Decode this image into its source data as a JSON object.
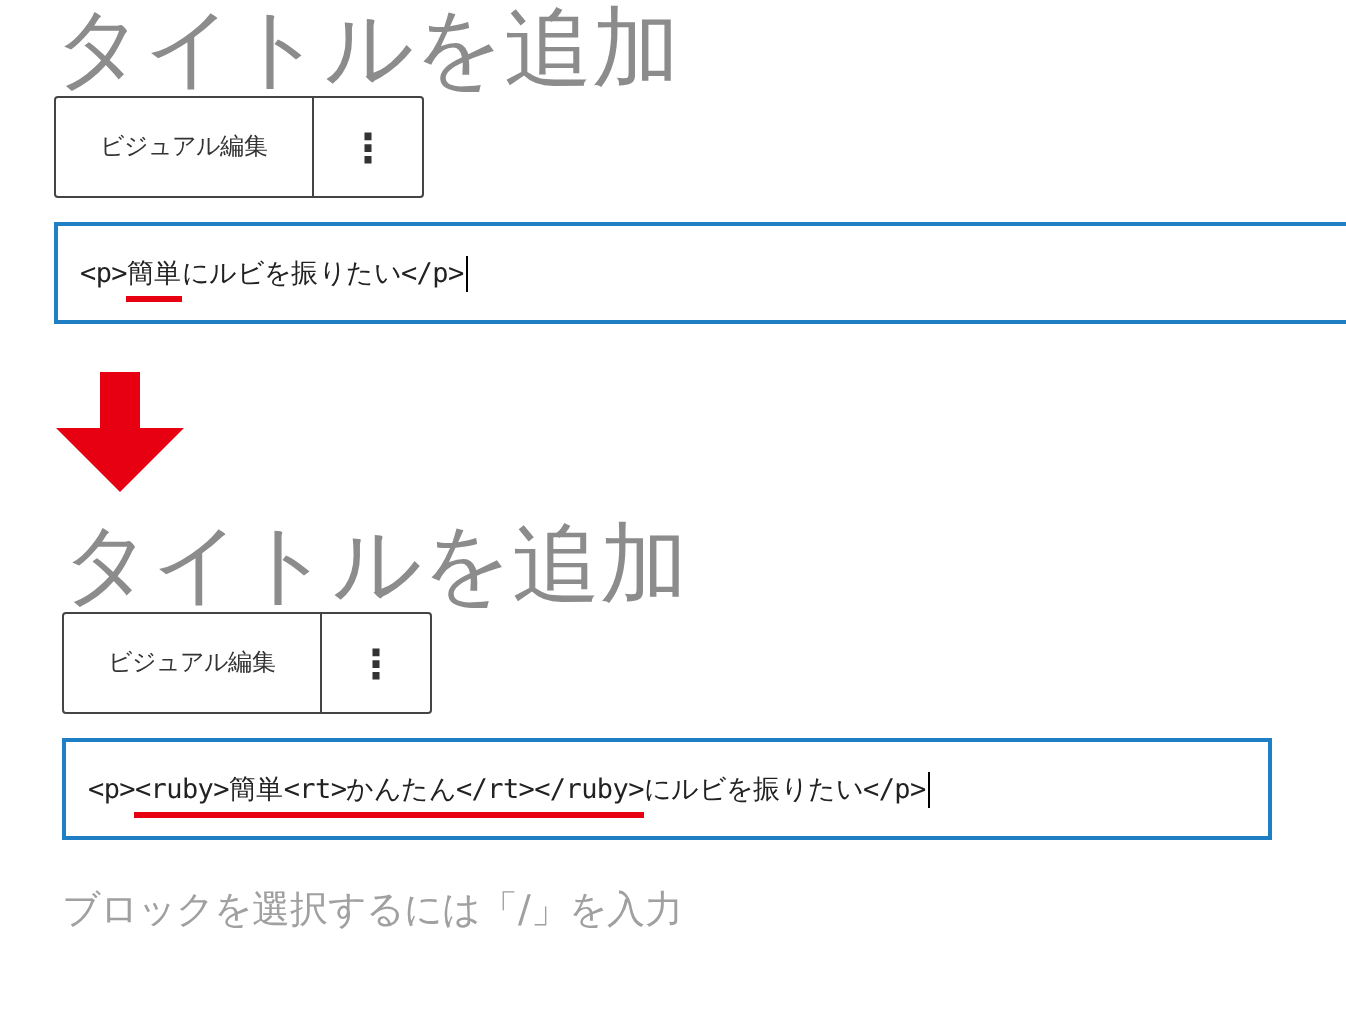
{
  "sections": [
    {
      "title": "タイトルを追加",
      "toolbar": {
        "mode_button": "ビジュアル編集",
        "menu_button": "⋮"
      },
      "field": {
        "value": "<p>簡単にルビを振りたい</p>",
        "focused": true
      }
    },
    {
      "title": "タイトルを追加",
      "toolbar": {
        "mode_button": "ビジュアル編集",
        "menu_button": "⋮"
      },
      "field": {
        "value": "<p><ruby>簡単<rt>かんたん</rt></ruby>にルビを振りたい</p>",
        "focused": true
      }
    }
  ],
  "placeholder": "ブロックを選択するには「/」を入力"
}
